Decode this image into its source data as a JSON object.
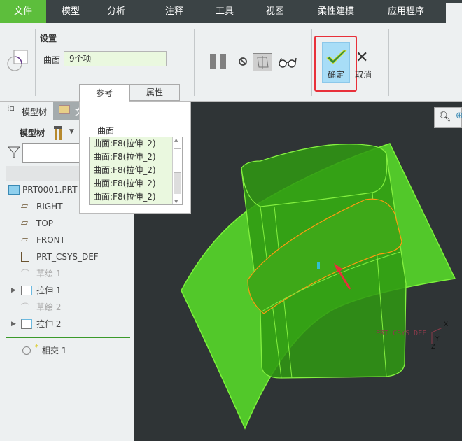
{
  "tabs": [
    {
      "label": "文件",
      "active": true
    },
    {
      "label": "模型"
    },
    {
      "label": "分析"
    },
    {
      "label": "注释"
    },
    {
      "label": "工具"
    },
    {
      "label": "视图"
    },
    {
      "label": "柔性建模"
    },
    {
      "label": "应用程序"
    }
  ],
  "settings": {
    "title": "设置",
    "surface_label": "曲面",
    "surface_value": "9个项"
  },
  "subtabs": [
    "参考",
    "属性"
  ],
  "actions": {
    "ok": "确定",
    "cancel": "取消"
  },
  "colors": {
    "accent": "#5cbf3a",
    "ok_bg": "#a8ddf7",
    "highlight": "#e8303a",
    "model": "#44c21c"
  },
  "popup": {
    "label": "曲面",
    "items": [
      "曲面:F8(拉伸_2)",
      "曲面:F8(拉伸_2)",
      "曲面:F8(拉伸_2)",
      "曲面:F8(拉伸_2)",
      "曲面:F8(拉伸_2)"
    ]
  },
  "left": {
    "tab_model_tree": "模型树",
    "tab_file": "文",
    "toolbar_label": "模型树",
    "filter_value": ""
  },
  "tree": [
    {
      "label": "PRT0001.PRT",
      "icon": "part-icon"
    },
    {
      "label": "RIGHT",
      "icon": "datum-plane-icon"
    },
    {
      "label": "TOP",
      "icon": "datum-plane-icon"
    },
    {
      "label": "FRONT",
      "icon": "datum-plane-icon"
    },
    {
      "label": "PRT_CSYS_DEF",
      "icon": "csys-icon"
    },
    {
      "label": "草绘 1",
      "icon": "sketch-icon",
      "dim": true
    },
    {
      "label": "拉伸 1",
      "icon": "extrude-icon",
      "expandable": true
    },
    {
      "label": "草绘 2",
      "icon": "sketch-icon",
      "dim": true
    },
    {
      "label": "拉伸 2",
      "icon": "extrude-icon",
      "expandable": true
    }
  ],
  "insert_item": {
    "label": "相交 1",
    "marker": "*"
  },
  "viewport": {
    "csys_label": "PRT_CSYS_DEF",
    "axes": [
      "X",
      "Y",
      "Z"
    ]
  }
}
